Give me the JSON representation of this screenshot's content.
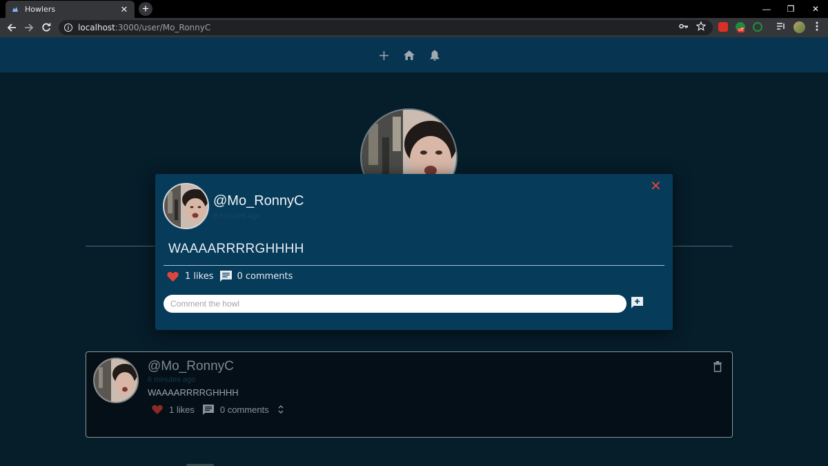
{
  "browser": {
    "tab_title": "Howlers",
    "url_host": "localhost",
    "url_path": ":3000/user/Mo_RonnyC",
    "ext_badge": "off",
    "icons": [
      "favicon-icon",
      "close-icon",
      "plus-icon",
      "back-icon",
      "forward-icon",
      "reload-icon",
      "info-icon",
      "key-icon",
      "star-icon",
      "playlist-icon",
      "profile-avatar",
      "menu-icon"
    ]
  },
  "app_header": {
    "icons": [
      "plus-icon",
      "home-icon",
      "bell-icon"
    ]
  },
  "modal": {
    "username": "@Mo_RonnyC",
    "time": "6 minutes ago",
    "howl_text": "WAAAARRRRGHHHH",
    "likes": "1 likes",
    "comments": "0 comments",
    "comment_placeholder": "Comment the howl"
  },
  "howl_card": {
    "username": "@Mo_RonnyC",
    "time": "6 minutes ago",
    "howl_text": "WAAAARRRRGHHHH",
    "likes": "1 likes",
    "comments": "0 comments"
  },
  "colors": {
    "page_bg": "#061d2a",
    "app_header_bg": "#063451",
    "modal_bg": "#063b5a",
    "heart": "#e0453c",
    "close": "#e0453c"
  }
}
